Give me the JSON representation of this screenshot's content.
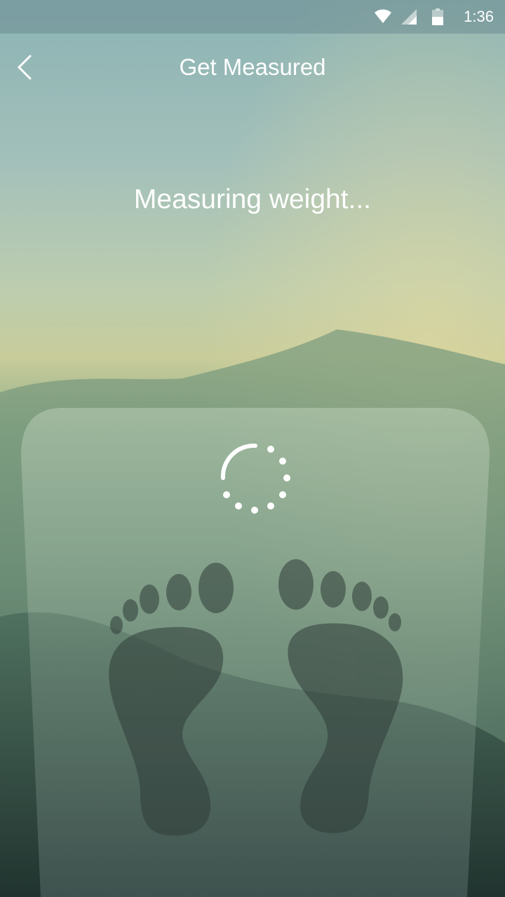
{
  "status_bar": {
    "time": "1:36",
    "icons": [
      "wifi-icon",
      "cell-signal-icon",
      "battery-icon"
    ]
  },
  "header": {
    "title": "Get Measured",
    "back_icon": "chevron-left-icon"
  },
  "main": {
    "status_text": "Measuring weight..."
  },
  "colors": {
    "text": "#ffffff",
    "footprint": "#2f3d38"
  }
}
